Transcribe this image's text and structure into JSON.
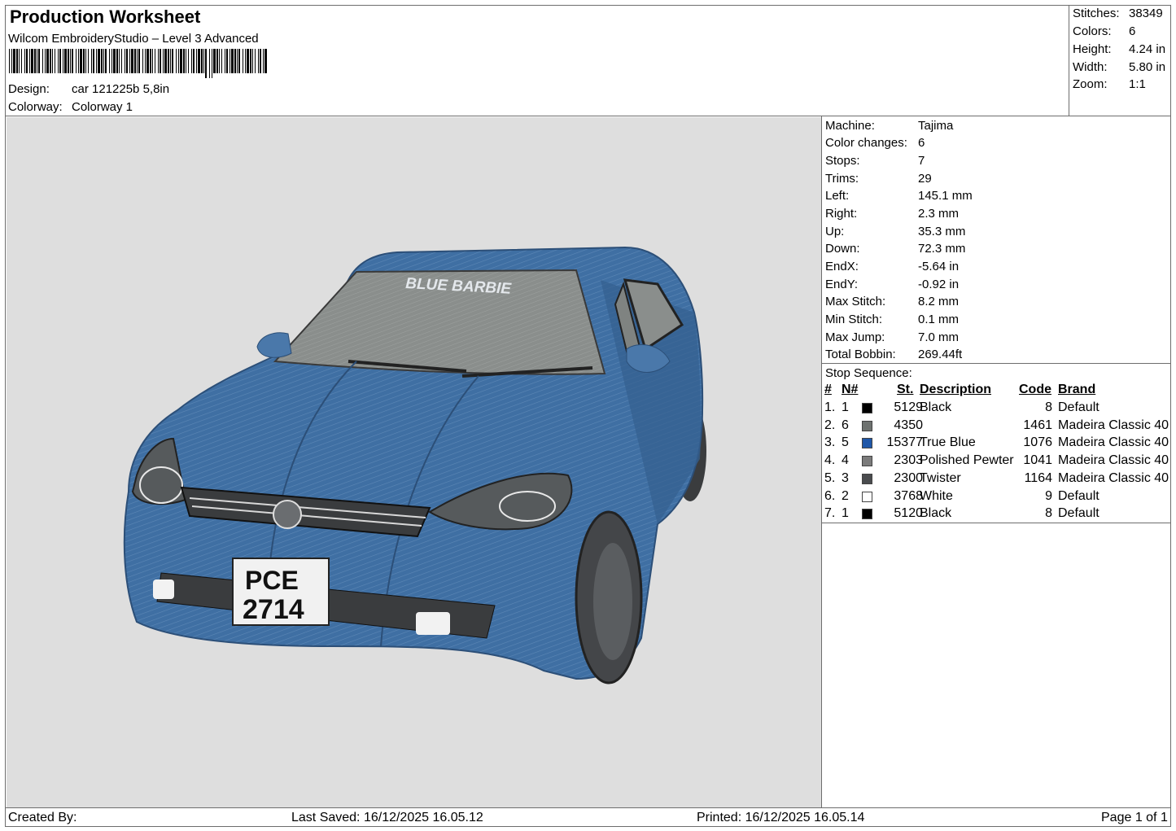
{
  "header": {
    "title": "Production Worksheet",
    "software": "Wilcom EmbroideryStudio – Level 3 Advanced",
    "design_label": "Design:",
    "design_value": "car 121225b 5,8in",
    "colorway_label": "Colorway:",
    "colorway_value": "Colorway 1"
  },
  "stats": [
    {
      "label": "Stitches:",
      "value": "38349"
    },
    {
      "label": "Colors:",
      "value": "6"
    },
    {
      "label": "Height:",
      "value": "4.24 in"
    },
    {
      "label": "Width:",
      "value": "5.80 in"
    },
    {
      "label": "Zoom:",
      "value": "1:1"
    }
  ],
  "preview": {
    "windshield_text": "BLUE BARBIE",
    "plate_line1": "PCE",
    "plate_line2": "2714",
    "colors": {
      "background": "#dedede",
      "body": "#3f6fa3",
      "glass": "#8a8e8c"
    }
  },
  "machine_info": [
    {
      "label": "Machine:",
      "value": "Tajima"
    },
    {
      "label": "Color changes:",
      "value": "6"
    },
    {
      "label": "Stops:",
      "value": "7"
    },
    {
      "label": "Trims:",
      "value": "29"
    },
    {
      "label": "Left:",
      "value": "145.1 mm"
    },
    {
      "label": "Right:",
      "value": "2.3 mm"
    },
    {
      "label": "Up:",
      "value": "35.3 mm"
    },
    {
      "label": "Down:",
      "value": "72.3 mm"
    },
    {
      "label": "EndX:",
      "value": "-5.64 in"
    },
    {
      "label": "EndY:",
      "value": "-0.92 in"
    },
    {
      "label": "Max Stitch:",
      "value": "8.2 mm"
    },
    {
      "label": "Min Stitch:",
      "value": "0.1 mm"
    },
    {
      "label": "Max Jump:",
      "value": "7.0 mm"
    },
    {
      "label": "Total Bobbin:",
      "value": "269.44ft"
    }
  ],
  "stop_sequence": {
    "title": "Stop Sequence:",
    "headers": {
      "num": "#",
      "needle": "N#",
      "stitches": "St.",
      "description": "Description",
      "code": "Code",
      "brand": "Brand"
    },
    "rows": [
      {
        "num": "1.",
        "needle": "1",
        "color": "#000000",
        "stitches": "5129",
        "description": "Black",
        "code": "8",
        "brand": "Default"
      },
      {
        "num": "2.",
        "needle": "6",
        "color": "#6e7270",
        "stitches": "4350",
        "description": "",
        "code": "1461",
        "brand": "Madeira Classic 40"
      },
      {
        "num": "3.",
        "needle": "5",
        "color": "#1f57a8",
        "stitches": "15377",
        "description": "True Blue",
        "code": "1076",
        "brand": "Madeira Classic 40"
      },
      {
        "num": "4.",
        "needle": "4",
        "color": "#7b7b7b",
        "stitches": "2303",
        "description": "Polished Pewter",
        "code": "1041",
        "brand": "Madeira Classic 40"
      },
      {
        "num": "5.",
        "needle": "3",
        "color": "#4a4c4e",
        "stitches": "2300",
        "description": "Twister",
        "code": "1164",
        "brand": "Madeira Classic 40"
      },
      {
        "num": "6.",
        "needle": "2",
        "color": "#ffffff",
        "stitches": "3768",
        "description": "White",
        "code": "9",
        "brand": "Default"
      },
      {
        "num": "7.",
        "needle": "1",
        "color": "#000000",
        "stitches": "5120",
        "description": "Black",
        "code": "8",
        "brand": "Default"
      }
    ]
  },
  "footer": {
    "created_by": "Created By:",
    "last_saved": "Last Saved: 16/12/2025 16.05.12",
    "printed": "Printed: 16/12/2025 16.05.14",
    "page": "Page 1 of 1"
  }
}
